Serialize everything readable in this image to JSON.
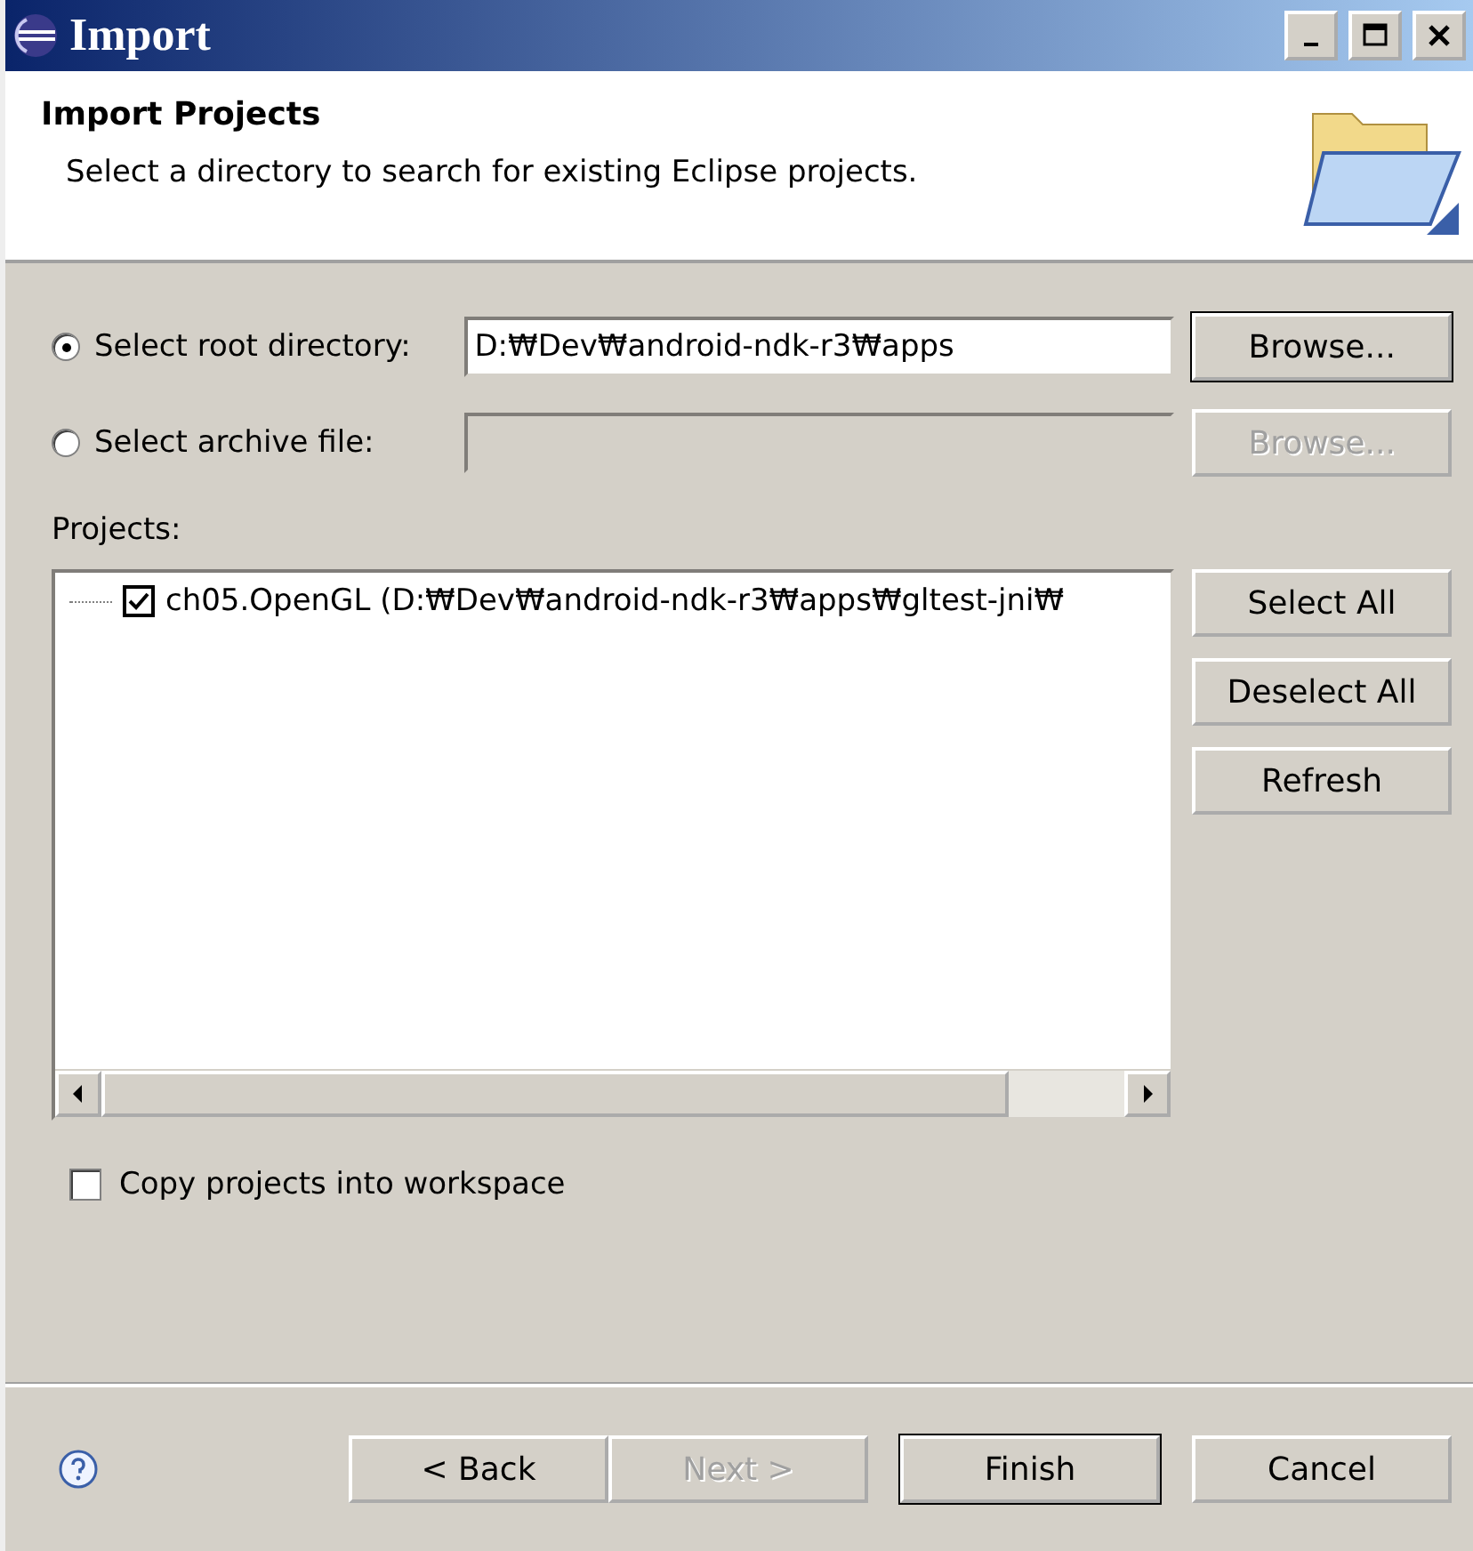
{
  "window": {
    "title": "Import"
  },
  "header": {
    "title": "Import Projects",
    "description": "Select a directory to search for existing Eclipse projects."
  },
  "sources": [
    {
      "label": "Select root directory:",
      "selected": true,
      "value": "D:₩Dev₩android-ndk-r3₩apps",
      "disabled": false,
      "browse": "Browse..."
    },
    {
      "label": "Select archive file:",
      "selected": false,
      "disabled": true,
      "browse": "Browse..."
    }
  ],
  "projects": {
    "label": "Projects:",
    "items": [
      {
        "label": "ch05.OpenGL (D:₩Dev₩android-ndk-r3₩apps₩gltest-jni₩",
        "checked": true
      }
    ],
    "buttons": [
      "Select All",
      "Deselect All",
      "Refresh"
    ]
  },
  "copy_option": {
    "label": "Copy projects into workspace",
    "checked": false
  },
  "footer_buttons": [
    {
      "label": "< Back",
      "disabled": false,
      "default": false
    },
    {
      "label": "Next >",
      "disabled": true,
      "default": false
    },
    {
      "label": "Finish",
      "disabled": false,
      "default": true
    },
    {
      "label": "Cancel",
      "disabled": false,
      "default": false
    }
  ]
}
